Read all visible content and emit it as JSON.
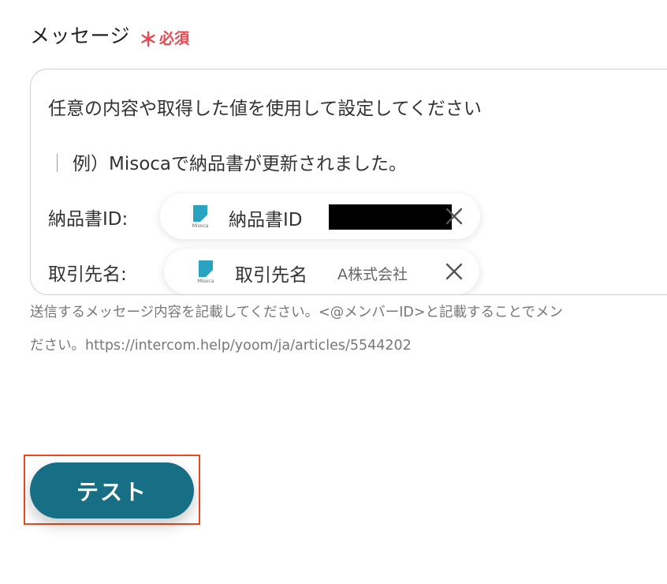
{
  "field": {
    "label": "メッセージ",
    "required_mark": "＊",
    "required_text": "必須"
  },
  "message": {
    "line1": "任意の内容や取得した値を使用して設定してください",
    "line2_bar": "｜",
    "line2": "例）Misocaで納品書が更新されました。",
    "rows": [
      {
        "label": "納品書ID:",
        "chip": {
          "brand": "Misoca",
          "label": "納品書ID",
          "value": "",
          "redacted": true,
          "icon": "misoca-logo-icon"
        }
      },
      {
        "label": "取引先名:",
        "chip": {
          "brand": "Misoca",
          "label": "取引先名",
          "value": "A株式会社",
          "icon": "misoca-logo-icon"
        }
      }
    ]
  },
  "help": {
    "line1": "送信するメッセージ内容を記載してください。<@メンバーID>と記載することでメン",
    "line2": "ださい。https://intercom.help/yoom/ja/articles/5544202"
  },
  "actions": {
    "test_label": "テスト"
  },
  "colors": {
    "accent": "#176f85",
    "required": "#e8474f",
    "highlight": "#ec4a1e",
    "misoca": "#2aa3c0"
  }
}
